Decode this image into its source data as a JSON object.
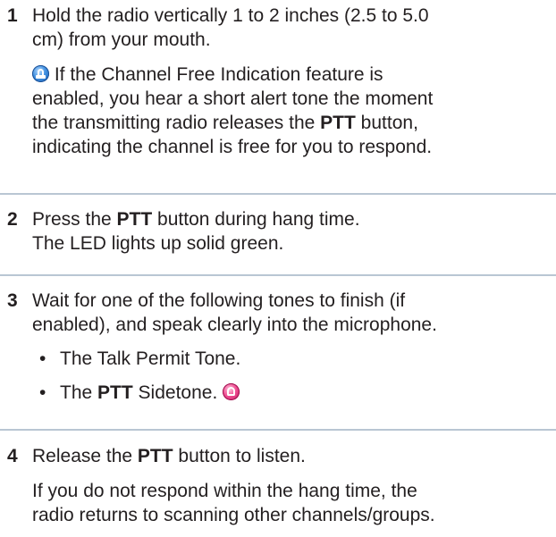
{
  "steps": [
    {
      "number": "1",
      "lines": [
        "Hold the radio vertically 1 to 2 inches (2.5 to 5.0",
        "cm) from your mouth."
      ],
      "note": {
        "icon": "info-icon",
        "line1": "If the Channel Free Indication feature is",
        "line2": "enabled, you hear a short alert tone the moment",
        "line3_pre": "the transmitting radio releases the ",
        "line3_bold": "PTT",
        "line3_post": " button,",
        "line4": "indicating the channel is free for you to respond."
      }
    },
    {
      "number": "2",
      "line1_pre": "Press the ",
      "line1_bold": "PTT",
      "line1_post": " button during hang time.",
      "line2": "The LED lights up solid green."
    },
    {
      "number": "3",
      "lines": [
        "Wait for one of the following tones to finish (if",
        "enabled), and speak clearly into the microphone."
      ],
      "bullet_char": "•",
      "bullets": [
        {
          "text": "The Talk Permit Tone."
        },
        {
          "pre": "The ",
          "bold": "PTT",
          "post": " Sidetone.",
          "icon": "microphone-icon"
        }
      ]
    },
    {
      "number": "4",
      "line1_pre": "Release the ",
      "line1_bold": "PTT",
      "line1_post": " button to listen.",
      "followup": [
        "If you do not respond within the hang time, the",
        "radio returns to scanning other channels/groups."
      ]
    }
  ],
  "colors": {
    "text": "#231f20",
    "divider": "#b9c6d3",
    "info_icon": "#3f8fe0",
    "mic_icon": "#ef4f93"
  }
}
